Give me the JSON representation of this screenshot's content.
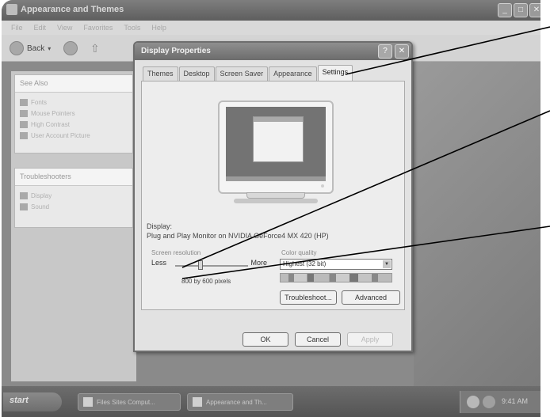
{
  "background_window": {
    "title": "Appearance and Themes",
    "menu": [
      "File",
      "Edit",
      "View",
      "Favorites",
      "Tools",
      "Help"
    ],
    "back_label": "Back"
  },
  "left_panel": {
    "see_also": {
      "title": "See Also",
      "items": [
        "Fonts",
        "Mouse Pointers",
        "High Contrast",
        "User Account Picture"
      ]
    },
    "troubleshooters": {
      "title": "Troubleshooters",
      "items": [
        "Display",
        "Sound"
      ]
    }
  },
  "dialog": {
    "title": "Display Properties",
    "tabs": [
      "Themes",
      "Desktop",
      "Screen Saver",
      "Appearance",
      "Settings"
    ],
    "active_tab": "Settings",
    "display_label": "Display:",
    "display_value": "Plug and Play Monitor on NVIDIA GeForce4 MX 420 (HP)",
    "screen_resolution": {
      "title": "Screen resolution",
      "less": "Less",
      "more": "More",
      "value": "800 by 600 pixels",
      "slider_position": 0.35
    },
    "color_quality": {
      "title": "Color quality",
      "selected": "Highest (32 bit)"
    },
    "buttons": {
      "troubleshoot": "Troubleshoot...",
      "advanced": "Advanced",
      "ok": "OK",
      "cancel": "Cancel",
      "apply": "Apply"
    }
  },
  "taskbar": {
    "start": "start",
    "tasks": [
      "Files Sites Comput...",
      "Appearance and Th..."
    ],
    "clock": "9:41 AM"
  }
}
